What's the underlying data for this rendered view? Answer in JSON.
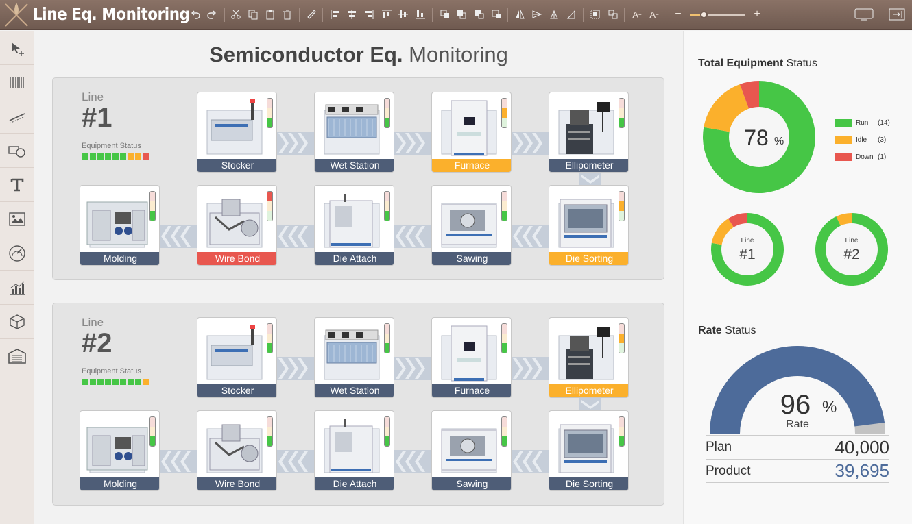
{
  "app": {
    "title": "Line Eq. Monitoring"
  },
  "page": {
    "title_bold": "Semiconductor Eq.",
    "title_rest": "Monitoring"
  },
  "toolbar": {
    "zoom_level": 0.25,
    "icons": [
      "undo-icon",
      "redo-icon",
      "cut-icon",
      "copy-icon",
      "paste-icon",
      "delete-icon",
      "format-painter-icon",
      "align-left-icon",
      "align-center-icon",
      "align-right-icon",
      "align-top-icon",
      "align-middle-icon",
      "align-bottom-icon",
      "bring-front-icon",
      "send-back-icon",
      "bring-forward-icon",
      "send-backward-icon",
      "flip-horizontal-icon",
      "flip-vertical-icon",
      "rotate-left-icon",
      "rotate-right-icon",
      "group-icon",
      "ungroup-icon",
      "font-increase-icon",
      "font-decrease-icon",
      "zoom-out-icon",
      "zoom-in-icon",
      "screen-icon",
      "exit-icon"
    ]
  },
  "sidebar": {
    "items": [
      "pointer-icon",
      "barcode-icon",
      "line-icon",
      "shapes-icon",
      "text-icon",
      "image-icon",
      "gauge-icon",
      "chart-icon",
      "cube-icon",
      "warehouse-icon"
    ]
  },
  "colors": {
    "run": "#46c646",
    "idle": "#fbb02c",
    "down": "#e8574f",
    "label_normal": "#4e5d77",
    "rate": "#4d6b9a"
  },
  "lines": [
    {
      "label": "Line",
      "number": "#1",
      "status_label": "Equipment Status",
      "status_cells": [
        "run",
        "run",
        "run",
        "run",
        "run",
        "run",
        "idle",
        "idle",
        "down"
      ],
      "machines": [
        {
          "name": "Stocker",
          "state": "normal",
          "lamp": "run"
        },
        {
          "name": "Wet Station",
          "state": "normal",
          "lamp": "run"
        },
        {
          "name": "Furnace",
          "state": "idle",
          "lamp": "idle"
        },
        {
          "name": "Ellipometer",
          "state": "normal",
          "lamp": "run"
        },
        {
          "name": "Molding",
          "state": "normal",
          "lamp": "run"
        },
        {
          "name": "Wire Bond",
          "state": "down",
          "lamp": "down"
        },
        {
          "name": "Die Attach",
          "state": "normal",
          "lamp": "run"
        },
        {
          "name": "Sawing",
          "state": "normal",
          "lamp": "run"
        },
        {
          "name": "Die Sorting",
          "state": "idle",
          "lamp": "idle"
        }
      ]
    },
    {
      "label": "Line",
      "number": "#2",
      "status_label": "Equipment Status",
      "status_cells": [
        "run",
        "run",
        "run",
        "run",
        "run",
        "run",
        "run",
        "run",
        "idle"
      ],
      "machines": [
        {
          "name": "Stocker",
          "state": "normal",
          "lamp": "run"
        },
        {
          "name": "Wet Station",
          "state": "normal",
          "lamp": "run"
        },
        {
          "name": "Furnace",
          "state": "normal",
          "lamp": "run"
        },
        {
          "name": "Ellipometer",
          "state": "idle",
          "lamp": "idle"
        },
        {
          "name": "Molding",
          "state": "normal",
          "lamp": "run"
        },
        {
          "name": "Wire Bond",
          "state": "normal",
          "lamp": "run"
        },
        {
          "name": "Die Attach",
          "state": "normal",
          "lamp": "run"
        },
        {
          "name": "Sawing",
          "state": "normal",
          "lamp": "run"
        },
        {
          "name": "Die Sorting",
          "state": "normal",
          "lamp": "run"
        }
      ]
    }
  ],
  "total_status": {
    "title_bold": "Total Equipment",
    "title_rest": "Status",
    "percent": "78",
    "percent_sign": "%",
    "legend": [
      {
        "name": "Run",
        "count": "(14)",
        "value": 14,
        "color": "#46c646"
      },
      {
        "name": "Idle",
        "count": "(3)",
        "value": 3,
        "color": "#fbb02c"
      },
      {
        "name": "Down",
        "count": "(1)",
        "value": 1,
        "color": "#e8574f"
      }
    ],
    "line_donuts": [
      {
        "label": "Line",
        "number": "#1",
        "run": 7,
        "idle": 1.2,
        "down": 0.8
      },
      {
        "label": "Line",
        "number": "#2",
        "run": 9.3,
        "idle": 0.7,
        "down": 0
      }
    ]
  },
  "rate_status": {
    "title_bold": "Rate",
    "title_rest": "Status",
    "percent": "96",
    "percent_sign": "%",
    "caption": "Rate",
    "fraction": 0.96,
    "plan_label": "Plan",
    "plan_value": "40,000",
    "product_label": "Product",
    "product_value": "39,695"
  }
}
